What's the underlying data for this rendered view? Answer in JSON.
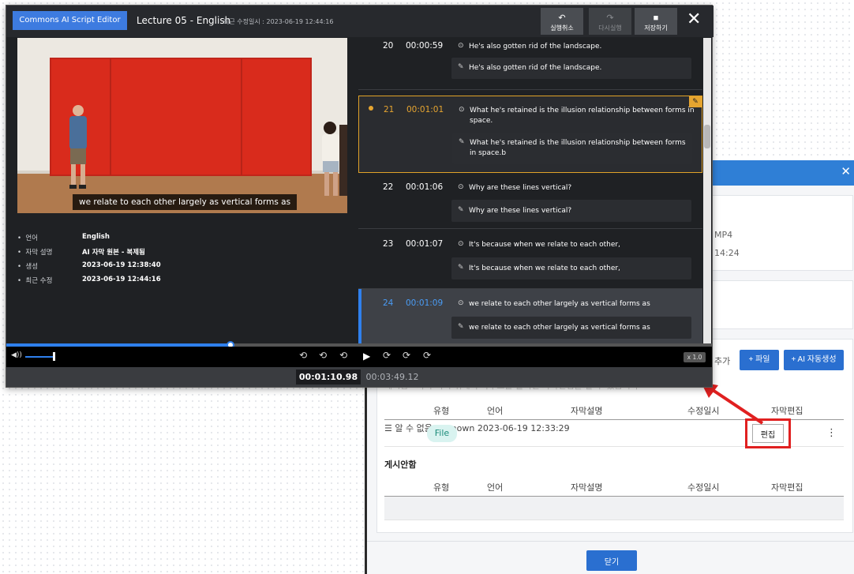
{
  "editor": {
    "app_badge": "Commons AI Script Editor",
    "title": "Lecture 05 - English",
    "last_modified": "최근 수정일시 : 2023-06-19 12:44:16",
    "undo_label": "실행취소",
    "redo_label": "다시실행",
    "save_label": "저장하기",
    "close_glyph": "✕"
  },
  "video": {
    "subtitle": "we relate to each other largely as vertical forms as"
  },
  "info": [
    {
      "key": "언어",
      "value": "English"
    },
    {
      "key": "자막 설명",
      "value": "AI 자막 원본 - 복제됨"
    },
    {
      "key": "생성",
      "value": "2023-06-19 12:38:40"
    },
    {
      "key": "최근 수정",
      "value": "2023-06-19 12:44:16"
    }
  ],
  "subtitles": [
    {
      "num": "20",
      "time": "00:00:59",
      "original": "He's also gotten rid of the landscape.",
      "edited": "He's also gotten rid of the landscape."
    },
    {
      "num": "21",
      "time": "00:01:01",
      "original": "What he's retained is the illusion relationship between forms in space.",
      "edited": "What he's retained is the illusion relationship between forms in space.b"
    },
    {
      "num": "22",
      "time": "00:01:06",
      "original": "Why are these lines vertical?",
      "edited": "Why are these lines vertical?"
    },
    {
      "num": "23",
      "time": "00:01:07",
      "original": "It's because when we relate to each other,",
      "edited": "It's because when we relate to each other,"
    },
    {
      "num": "24",
      "time": "00:01:09",
      "original": "we relate to each other largely as vertical forms as",
      "edited": "we relate to each other largely as vertical forms as"
    }
  ],
  "player": {
    "current_time": "00:01:10.98",
    "total_time": "00:03:49.12",
    "speed": "x 1.0",
    "progress_percent": 31.8
  },
  "background_dialog": {
    "meta_format": "MP4",
    "meta_time": "14:24",
    "add_label": "추가",
    "file_button": "+ 파일",
    "ai_button": "+ AI 자동생성",
    "faded_text": "게시함  · 자막 목록 위에서 마우스를 올리면 자막편집을 할 수 있습니다",
    "published_columns": [
      "유형",
      "언어",
      "자막설명",
      "수정일시",
      "자막편집"
    ],
    "row": {
      "handle": "☰",
      "type": "File",
      "language": "알 수 없음",
      "description": "unknown",
      "modified": "2023-06-19 12:33:29",
      "edit_button": "편집",
      "more": "⋮"
    },
    "unpublished_title": "게시안함",
    "unpublished_columns": [
      "유형",
      "언어",
      "자막설명",
      "수정일시",
      "자막편집"
    ],
    "close_button": "닫기"
  }
}
